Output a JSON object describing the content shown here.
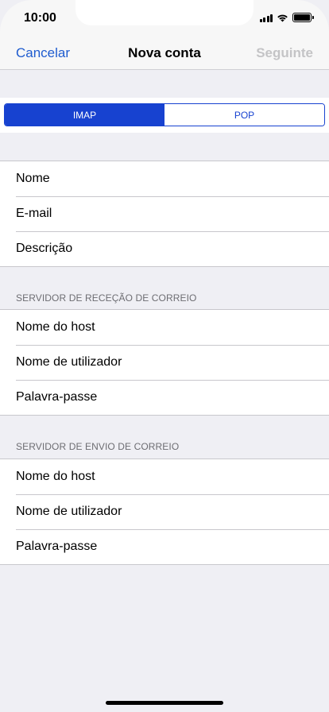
{
  "status": {
    "time": "10:00",
    "battery_level": 1.0
  },
  "nav": {
    "cancel_label": "Cancelar",
    "title": "Nova conta",
    "next_label": "Seguinte"
  },
  "segmented": {
    "options": [
      "IMAP",
      "POP"
    ],
    "selected": "IMAP"
  },
  "account_fields": [
    "Nome",
    "E-mail",
    "Descrição"
  ],
  "incoming": {
    "header": "SERVIDOR DE RECEÇÃO DE CORREIO",
    "fields": [
      "Nome do host",
      "Nome de utilizador",
      "Palavra-passe"
    ]
  },
  "outgoing": {
    "header": "SERVIDOR DE ENVIO DE CORREIO",
    "fields": [
      "Nome do host",
      "Nome de utilizador",
      "Palavra-passe"
    ]
  },
  "colors": {
    "accent": "#1742d0",
    "link": "#1f5ccf",
    "disabled": "#c4c4c6",
    "background": "#efeff4"
  }
}
